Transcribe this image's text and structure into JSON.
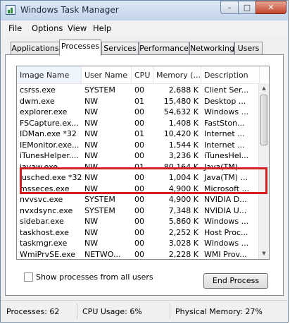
{
  "window": {
    "title": "Windows Task Manager",
    "min_label": "–",
    "max_label": "□",
    "close_label": "✕"
  },
  "menu": [
    "File",
    "Options",
    "View",
    "Help"
  ],
  "tabs": [
    {
      "label": "Applications"
    },
    {
      "label": "Processes",
      "active": true
    },
    {
      "label": "Services"
    },
    {
      "label": "Performance"
    },
    {
      "label": "Networking"
    },
    {
      "label": "Users"
    }
  ],
  "columns": [
    "Image Name",
    "User Name",
    "CPU",
    "Memory (...",
    "Description"
  ],
  "sorted_column": "Image Name",
  "rows": [
    {
      "name": "csrss.exe",
      "user": "SYSTEM",
      "cpu": "00",
      "mem": "2,688 K",
      "desc": "Client Ser..."
    },
    {
      "name": "dwm.exe",
      "user": "NW",
      "cpu": "01",
      "mem": "15,480 K",
      "desc": "Desktop ..."
    },
    {
      "name": "explorer.exe",
      "user": "NW",
      "cpu": "00",
      "mem": "54,632 K",
      "desc": "Windows ..."
    },
    {
      "name": "FSCapture.ex...",
      "user": "NW",
      "cpu": "00",
      "mem": "1,408 K",
      "desc": "FastSton..."
    },
    {
      "name": "IDMan.exe *32",
      "user": "NW",
      "cpu": "01",
      "mem": "10,420 K",
      "desc": "Internet ..."
    },
    {
      "name": "IEMonitor.exe...",
      "user": "NW",
      "cpu": "00",
      "mem": "1,544 K",
      "desc": "Internet ..."
    },
    {
      "name": "iTunesHelper....",
      "user": "NW",
      "cpu": "00",
      "mem": "3,236 K",
      "desc": "iTunesHel..."
    },
    {
      "name": "javaw.exe",
      "user": "NW",
      "cpu": "01",
      "mem": "80,164 K",
      "desc": "Java(TM) ..."
    },
    {
      "name": "jusched.exe *32",
      "user": "NW",
      "cpu": "00",
      "mem": "1,004 K",
      "desc": "Java(TM) ..."
    },
    {
      "name": "msseces.exe",
      "user": "NW",
      "cpu": "00",
      "mem": "4,900 K",
      "desc": "Microsoft ..."
    },
    {
      "name": "nvvsvc.exe",
      "user": "SYSTEM",
      "cpu": "00",
      "mem": "4,900 K",
      "desc": "NVIDIA D..."
    },
    {
      "name": "nvxdsync.exe",
      "user": "SYSTEM",
      "cpu": "00",
      "mem": "7,348 K",
      "desc": "NVIDIA U..."
    },
    {
      "name": "sidebar.exe",
      "user": "NW",
      "cpu": "00",
      "mem": "5,860 K",
      "desc": "Windows ..."
    },
    {
      "name": "taskhost.exe",
      "user": "NW",
      "cpu": "00",
      "mem": "2,252 K",
      "desc": "Host Proc..."
    },
    {
      "name": "taskmgr.exe",
      "user": "NW",
      "cpu": "00",
      "mem": "3,028 K",
      "desc": "Windows ..."
    },
    {
      "name": "WmiPrvSE.exe",
      "user": "NETWO...",
      "cpu": "00",
      "mem": "2,228 K",
      "desc": "WMI Prov..."
    }
  ],
  "show_all_label": "Show processes from all users",
  "show_all_checked": false,
  "end_process_label": "End Process",
  "status": {
    "processes": "Processes: 62",
    "cpu": "CPU Usage: 6%",
    "memory": "Physical Memory: 27%"
  },
  "colors": {
    "highlight": "#d81f1f"
  }
}
